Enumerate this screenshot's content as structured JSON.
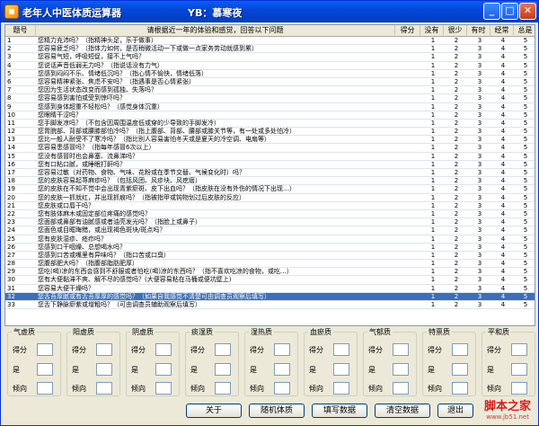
{
  "window": {
    "title": "老年人中医体质运算器",
    "author": "YB：慕寒夜",
    "min_label": "_",
    "max_label": "□",
    "close_label": "✕"
  },
  "table": {
    "headers": {
      "no": "题号",
      "question": "请根据近一年的体验和感觉，回答以下问题",
      "score": "得分",
      "v1": "没有",
      "v2": "很少",
      "v3": "有时",
      "v4": "经常",
      "v5": "总是"
    },
    "selected_row": 32,
    "rows": [
      {
        "no": "1",
        "q": "您精力充沛吗？（指精神头足，乐于做事）",
        "v": [
          "1",
          "2",
          "3",
          "4",
          "5"
        ]
      },
      {
        "no": "2",
        "q": "您容易疲乏吗？（指体力如何，是否稍微活动一下或做一点家务劳动就感到累）",
        "v": [
          "1",
          "2",
          "3",
          "4",
          "5"
        ]
      },
      {
        "no": "3",
        "q": "您容易气短，呼吸短促，接不上气吗？",
        "v": [
          "1",
          "2",
          "3",
          "4",
          "5"
        ]
      },
      {
        "no": "4",
        "q": "您说话声音低弱无力吗？（指说话没有力气）",
        "v": [
          "1",
          "2",
          "3",
          "4",
          "5"
        ]
      },
      {
        "no": "5",
        "q": "您感到闷闷不乐、情绪低沉吗？（指心情不愉快，情绪低落）",
        "v": [
          "1",
          "2",
          "3",
          "4",
          "5"
        ]
      },
      {
        "no": "6",
        "q": "您容易精神紧张、焦虑不安吗？（指遇事是否心情紧张）",
        "v": [
          "1",
          "2",
          "3",
          "4",
          "5"
        ]
      },
      {
        "no": "7",
        "q": "您因为生活状态改变而感到孤独、失落吗？",
        "v": [
          "1",
          "2",
          "3",
          "4",
          "5"
        ]
      },
      {
        "no": "8",
        "q": "您容易感到害怕或受到惊吓吗？",
        "v": [
          "1",
          "2",
          "3",
          "4",
          "5"
        ]
      },
      {
        "no": "9",
        "q": "您感到身体超重不轻松吗？（感觉身体沉重）",
        "v": [
          "1",
          "2",
          "3",
          "4",
          "5"
        ]
      },
      {
        "no": "10",
        "q": "您眼睛干涩吗？",
        "v": [
          "1",
          "2",
          "3",
          "4",
          "5"
        ]
      },
      {
        "no": "11",
        "q": "您手脚发凉吗？（不包含因周围温度低或穿的少导致的手脚发冷）",
        "v": [
          "1",
          "2",
          "3",
          "4",
          "5"
        ]
      },
      {
        "no": "12",
        "q": "您胃脘部、背部或腰膝部怕冷吗？（指上腹部、背部、腰部或膝关节等，有一处或多处怕冷）",
        "v": [
          "1",
          "2",
          "3",
          "4",
          "5"
        ]
      },
      {
        "no": "13",
        "q": "您比一般人耐受不了寒冷吗？（指比别人容易害怕冬天或是夏天的冷空调、电扇等）",
        "v": [
          "1",
          "2",
          "3",
          "4",
          "5"
        ]
      },
      {
        "no": "14",
        "q": "您容易患感冒吗？（指每年感冒6次以上）",
        "v": [
          "1",
          "2",
          "3",
          "4",
          "5"
        ]
      },
      {
        "no": "15",
        "q": "您没有感冒时也会鼻塞、流鼻涕吗？",
        "v": [
          "1",
          "2",
          "3",
          "4",
          "5"
        ]
      },
      {
        "no": "16",
        "q": "您有口粘口腻，或睡眠打鼾吗？",
        "v": [
          "1",
          "2",
          "3",
          "4",
          "5"
        ]
      },
      {
        "no": "17",
        "q": "您容易过敏（对药物、食物、气味、花粉或在季节交替、气候变化时）吗？",
        "v": [
          "1",
          "2",
          "3",
          "4",
          "5"
        ]
      },
      {
        "no": "18",
        "q": "您的皮肤容易起荨麻疹吗？（包括风团、风疹块、风疙瘩）",
        "v": [
          "1",
          "2",
          "3",
          "4",
          "5"
        ]
      },
      {
        "no": "19",
        "q": "您的皮肤在不知不觉中会出现青紫瘀斑、皮下出血吗？（指皮肤在没有外伤的情况下出现…）",
        "v": [
          "1",
          "2",
          "3",
          "4",
          "5"
        ]
      },
      {
        "no": "20",
        "q": "您的皮肤一抓就红，并出现抓痕吗？（指被指甲或钝物划过后皮肤的反应）",
        "v": [
          "1",
          "2",
          "3",
          "4",
          "5"
        ]
      },
      {
        "no": "21",
        "q": "您皮肤或口唇干吗？",
        "v": [
          "1",
          "2",
          "3",
          "4",
          "5"
        ]
      },
      {
        "no": "22",
        "q": "您有肢体麻木或固定部位疼痛的感觉吗？",
        "v": [
          "1",
          "2",
          "3",
          "4",
          "5"
        ]
      },
      {
        "no": "23",
        "q": "您面部或鼻部有油腻感或者油亮发光吗？（指脸上或鼻子）",
        "v": [
          "1",
          "2",
          "3",
          "4",
          "5"
        ]
      },
      {
        "no": "24",
        "q": "您面色或目眶晦黯，或出现褐色斑块/斑点吗？",
        "v": [
          "1",
          "2",
          "3",
          "4",
          "5"
        ]
      },
      {
        "no": "25",
        "q": "您有皮肤湿疹、疮疖吗？",
        "v": [
          "1",
          "2",
          "3",
          "4",
          "5"
        ]
      },
      {
        "no": "26",
        "q": "您感到口干咽燥、总想喝水吗？",
        "v": [
          "1",
          "2",
          "3",
          "4",
          "5"
        ]
      },
      {
        "no": "27",
        "q": "您感到口苦或嘴里有异味吗？（指口苦或口臭）",
        "v": [
          "1",
          "2",
          "3",
          "4",
          "5"
        ]
      },
      {
        "no": "28",
        "q": "您腹部肥大吗？（指腹部脂肪肥厚）",
        "v": [
          "1",
          "2",
          "3",
          "4",
          "5"
        ]
      },
      {
        "no": "29",
        "q": "您吃(喝)凉的东西会感到不舒服或者怕吃(喝)凉的东西吗？（指不喜欢吃凉的食物，或吃…）",
        "v": [
          "1",
          "2",
          "3",
          "4",
          "5"
        ]
      },
      {
        "no": "30",
        "q": "您有大便黏滞不爽、解不尽的感觉吗？(大便容易粘在马桶或便坑壁上)",
        "v": [
          "1",
          "2",
          "3",
          "4",
          "5"
        ]
      },
      {
        "no": "31",
        "q": "您容易大便干燥吗？",
        "v": [
          "1",
          "2",
          "3",
          "4",
          "5"
        ]
      },
      {
        "no": "32",
        "q": "您舌苔厚腻或有舌苔厚厚的感觉吗？（如果自我感觉不清楚可由调查员观察后填写）",
        "v": [
          "1",
          "2",
          "3",
          "4",
          "5"
        ]
      },
      {
        "no": "33",
        "q": "您舌下静脉瘀紫或增粗吗？（可由调查员辅助观察后填写）",
        "v": [
          "1",
          "2",
          "3",
          "4",
          "5"
        ]
      }
    ]
  },
  "groups": [
    {
      "title": "气虚质",
      "score_label": "得分",
      "yes_label": "是",
      "tendency_label": "倾向"
    },
    {
      "title": "阳虚质",
      "score_label": "得分",
      "yes_label": "是",
      "tendency_label": "倾向"
    },
    {
      "title": "阴虚质",
      "score_label": "得分",
      "yes_label": "是",
      "tendency_label": "倾向"
    },
    {
      "title": "痰湿质",
      "score_label": "得分",
      "yes_label": "是",
      "tendency_label": "倾向"
    },
    {
      "title": "湿热质",
      "score_label": "得分",
      "yes_label": "是",
      "tendency_label": "倾向"
    },
    {
      "title": "血瘀质",
      "score_label": "得分",
      "yes_label": "是",
      "tendency_label": "倾向"
    },
    {
      "title": "气郁质",
      "score_label": "得分",
      "yes_label": "是",
      "tendency_label": "倾向"
    },
    {
      "title": "特禀质",
      "score_label": "得分",
      "yes_label": "是",
      "tendency_label": "倾向"
    },
    {
      "title": "平和质",
      "score_label": "得分",
      "yes_label": "是",
      "tendency_label": "倾向"
    }
  ],
  "buttons": {
    "about": "关于",
    "random": "随机体质",
    "fill": "填写数据",
    "clear": "清空数据",
    "exit": "退出"
  },
  "watermark": {
    "text": "脚本之家",
    "url": "www.jb51.net"
  },
  "colors": {
    "title_bar": "#0447d8",
    "selection": "#3d6fb6",
    "watermark": "#d42020"
  }
}
